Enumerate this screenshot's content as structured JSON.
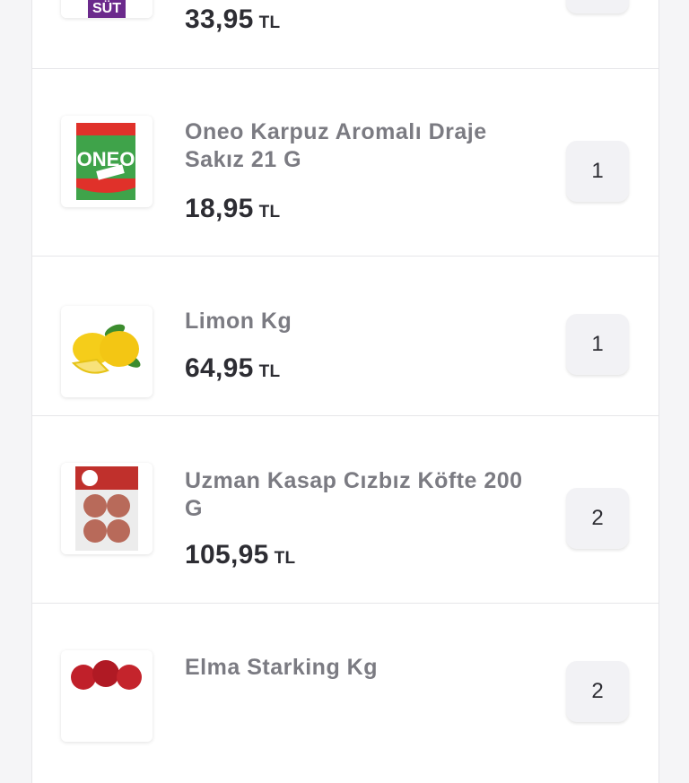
{
  "products": [
    {
      "name": "",
      "image": "milk-carton",
      "image_text": "SÜT",
      "price": "33,95",
      "currency": "TL",
      "quantity": ""
    },
    {
      "name": "Oneo Karpuz Aromalı Draje Sakız 21 G",
      "image": "oneo-gum-pack",
      "image_text": "ONEO",
      "price": "18,95",
      "currency": "TL",
      "quantity": "1"
    },
    {
      "name": "Limon Kg",
      "image": "lemons",
      "price": "64,95",
      "currency": "TL",
      "quantity": "1"
    },
    {
      "name": "Uzman Kasap Cızbız Köfte 200 G",
      "image": "meatball-pack",
      "price": "105,95",
      "currency": "TL",
      "quantity": "2"
    },
    {
      "name": "Elma Starking Kg",
      "image": "red-apples",
      "price": "",
      "currency": "",
      "quantity": "2"
    }
  ],
  "colors": {
    "name": "#7b7b82",
    "price": "#2d2d33",
    "background": "#f5f5f7",
    "qty_bg": "#f2f2f5"
  }
}
